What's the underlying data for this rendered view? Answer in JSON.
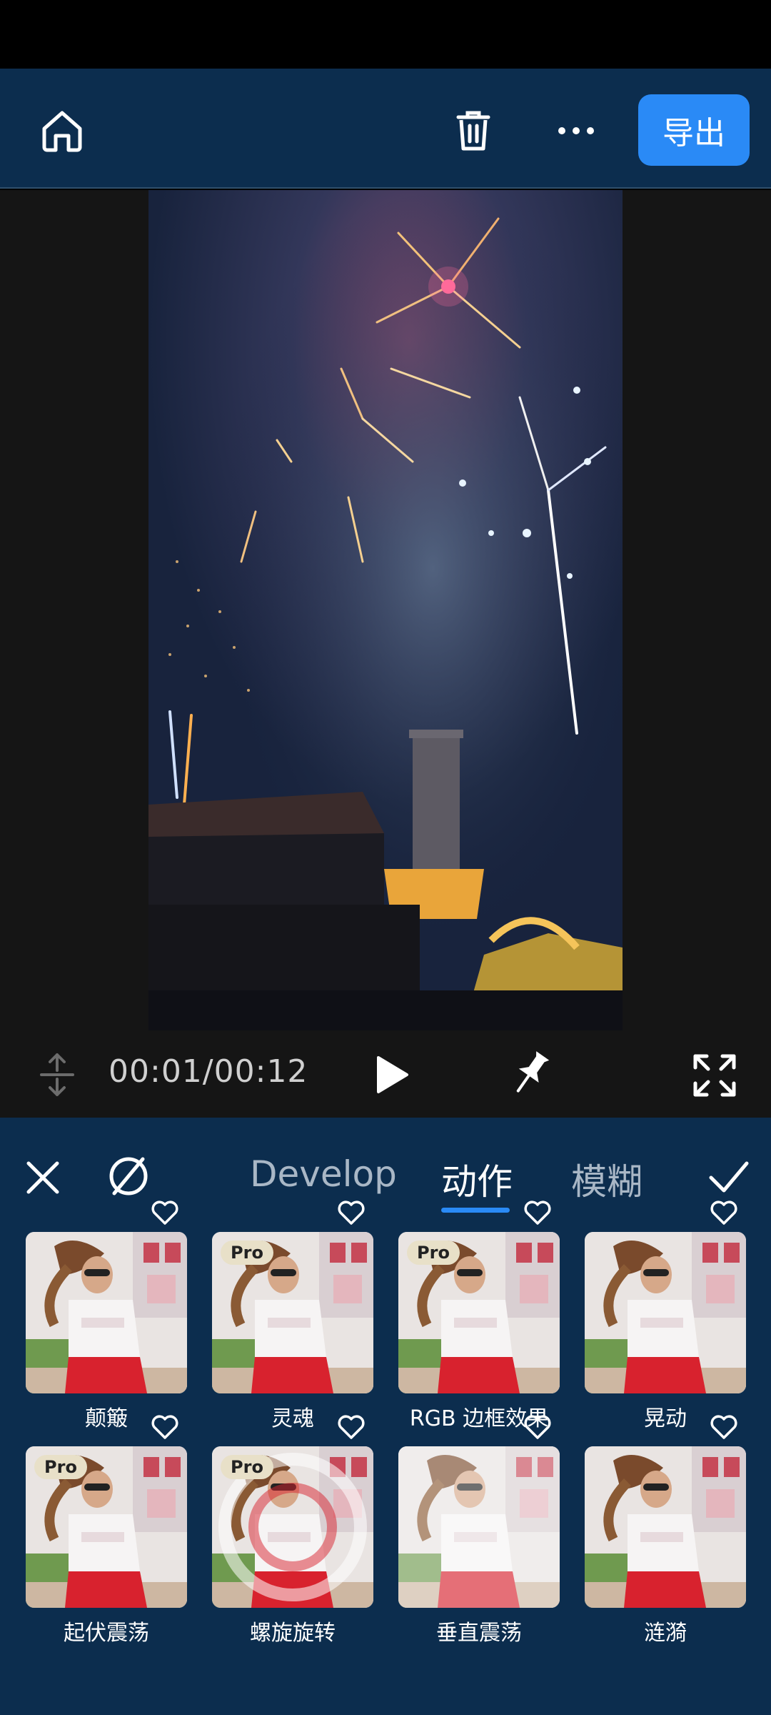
{
  "topbar": {
    "export_label": "导出"
  },
  "player": {
    "time": "00:01/00:12"
  },
  "tabs": {
    "develop": "Develop",
    "motion": "动作",
    "blur": "模糊"
  },
  "effects": [
    {
      "label": "颠簸",
      "pro": false
    },
    {
      "label": "灵魂",
      "pro": true,
      "pro_label": "Pro"
    },
    {
      "label": "RGB 边框效果",
      "pro": true,
      "pro_label": "Pro"
    },
    {
      "label": "晃动",
      "pro": false
    },
    {
      "label": "起伏震荡",
      "pro": true,
      "pro_label": "Pro"
    },
    {
      "label": "螺旋旋转",
      "pro": true,
      "pro_label": "Pro"
    },
    {
      "label": "垂直震荡",
      "pro": false
    },
    {
      "label": "涟漪",
      "pro": false
    }
  ],
  "colors": {
    "accent": "#2a8af6",
    "panel": "#0c2d4e"
  }
}
